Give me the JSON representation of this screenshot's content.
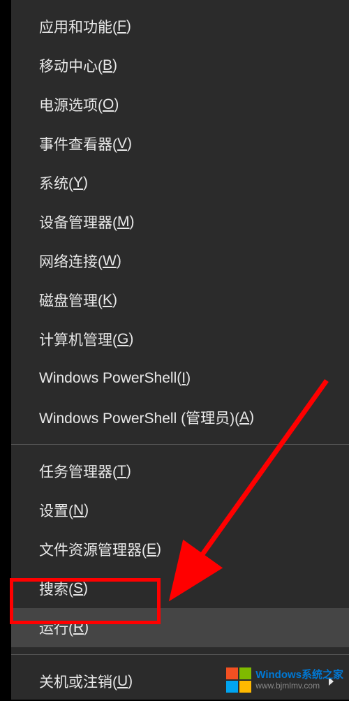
{
  "menu": {
    "groups": [
      {
        "items": [
          {
            "id": "apps-features",
            "label": "应用和功能(",
            "key": "F",
            "suffix": ")",
            "submenu": false
          },
          {
            "id": "mobility-center",
            "label": "移动中心(",
            "key": "B",
            "suffix": ")",
            "submenu": false
          },
          {
            "id": "power-options",
            "label": "电源选项(",
            "key": "O",
            "suffix": ")",
            "submenu": false
          },
          {
            "id": "event-viewer",
            "label": "事件查看器(",
            "key": "V",
            "suffix": ")",
            "submenu": false
          },
          {
            "id": "system",
            "label": "系统(",
            "key": "Y",
            "suffix": ")",
            "submenu": false
          },
          {
            "id": "device-manager",
            "label": "设备管理器(",
            "key": "M",
            "suffix": ")",
            "submenu": false
          },
          {
            "id": "network-connections",
            "label": "网络连接(",
            "key": "W",
            "suffix": ")",
            "submenu": false
          },
          {
            "id": "disk-management",
            "label": "磁盘管理(",
            "key": "K",
            "suffix": ")",
            "submenu": false
          },
          {
            "id": "computer-management",
            "label": "计算机管理(",
            "key": "G",
            "suffix": ")",
            "submenu": false
          },
          {
            "id": "powershell",
            "label": "Windows PowerShell(",
            "key": "I",
            "suffix": ")",
            "submenu": false
          },
          {
            "id": "powershell-admin",
            "label": "Windows PowerShell (管理员)(",
            "key": "A",
            "suffix": ")",
            "submenu": false
          }
        ]
      },
      {
        "items": [
          {
            "id": "task-manager",
            "label": "任务管理器(",
            "key": "T",
            "suffix": ")",
            "submenu": false
          },
          {
            "id": "settings",
            "label": "设置(",
            "key": "N",
            "suffix": ")",
            "submenu": false
          },
          {
            "id": "file-explorer",
            "label": "文件资源管理器(",
            "key": "E",
            "suffix": ")",
            "submenu": false
          },
          {
            "id": "search",
            "label": "搜索(",
            "key": "S",
            "suffix": ")",
            "submenu": false
          },
          {
            "id": "run",
            "label": "运行(",
            "key": "R",
            "suffix": ")",
            "submenu": false,
            "highlighted": true
          }
        ]
      },
      {
        "items": [
          {
            "id": "shutdown-signout",
            "label": "关机或注销(",
            "key": "U",
            "suffix": ")",
            "submenu": true
          }
        ]
      }
    ]
  },
  "watermark": {
    "title": "Windows系统之家",
    "url": "www.bjmlmv.com"
  }
}
